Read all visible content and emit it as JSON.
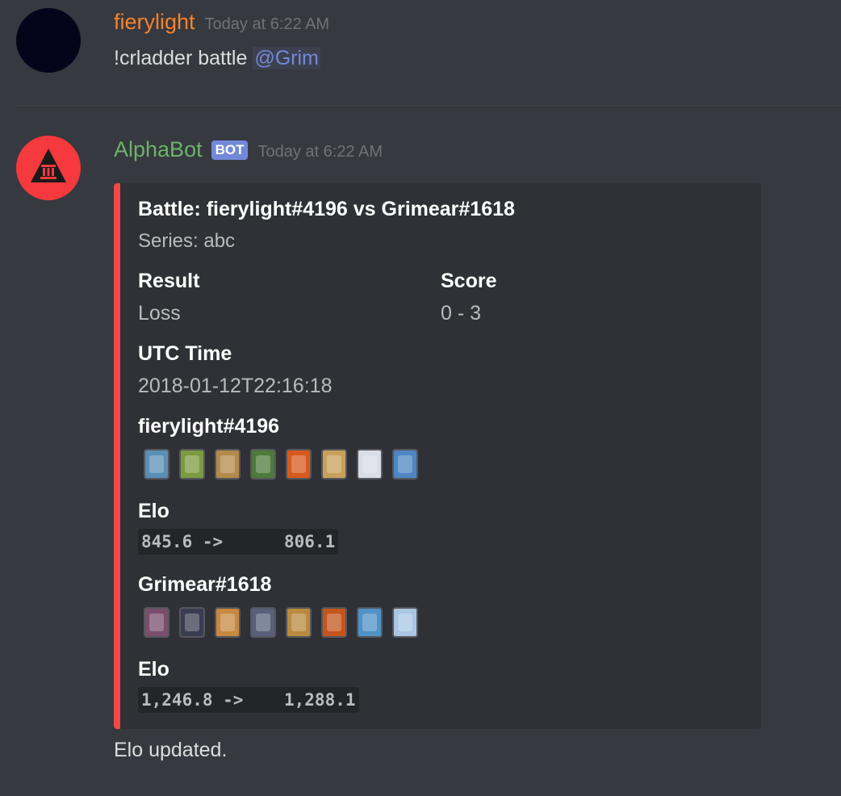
{
  "messages": [
    {
      "username": "fierylight",
      "username_color": "#f6832b",
      "timestamp": "Today at 6:22 AM",
      "text": "!crladder battle",
      "mention": "@Grim"
    },
    {
      "username": "AlphaBot",
      "username_color": "#6bb36a",
      "bot_tag": "BOT",
      "timestamp": "Today at 6:22 AM"
    }
  ],
  "embed": {
    "accent_color": "#f04747",
    "title": "Battle: fierylight#4196 vs Grimear#1618",
    "description": "Series: abc",
    "result_label": "Result",
    "result_value": "Loss",
    "score_label": "Score",
    "score_value": "0 - 3",
    "time_label": "UTC Time",
    "time_value": "2018-01-12T22:16:18",
    "player1": {
      "name": "fierylight#4196",
      "cards": [
        "card-1",
        "card-2",
        "card-3",
        "card-4",
        "card-5",
        "card-6",
        "card-7",
        "card-8"
      ],
      "card_colors": [
        "#5a8fb5",
        "#7d9a3f",
        "#b48a4a",
        "#4e7a3a",
        "#d8591f",
        "#c9a05a",
        "#d8dde6",
        "#4d86c2"
      ],
      "elo_label": "Elo",
      "elo_change": "845.6 ->      806.1"
    },
    "player2": {
      "name": "Grimear#1618",
      "cards": [
        "card-1",
        "card-2",
        "card-3",
        "card-4",
        "card-5",
        "card-6",
        "card-7",
        "card-8"
      ],
      "card_colors": [
        "#7a4d6e",
        "#3a3d52",
        "#c7883f",
        "#58607a",
        "#b98a3f",
        "#c4551c",
        "#4f92c8",
        "#a9c6e3"
      ],
      "elo_label": "Elo",
      "elo_change": "1,246.8 ->    1,288.1"
    }
  },
  "followup_text": "Elo updated."
}
